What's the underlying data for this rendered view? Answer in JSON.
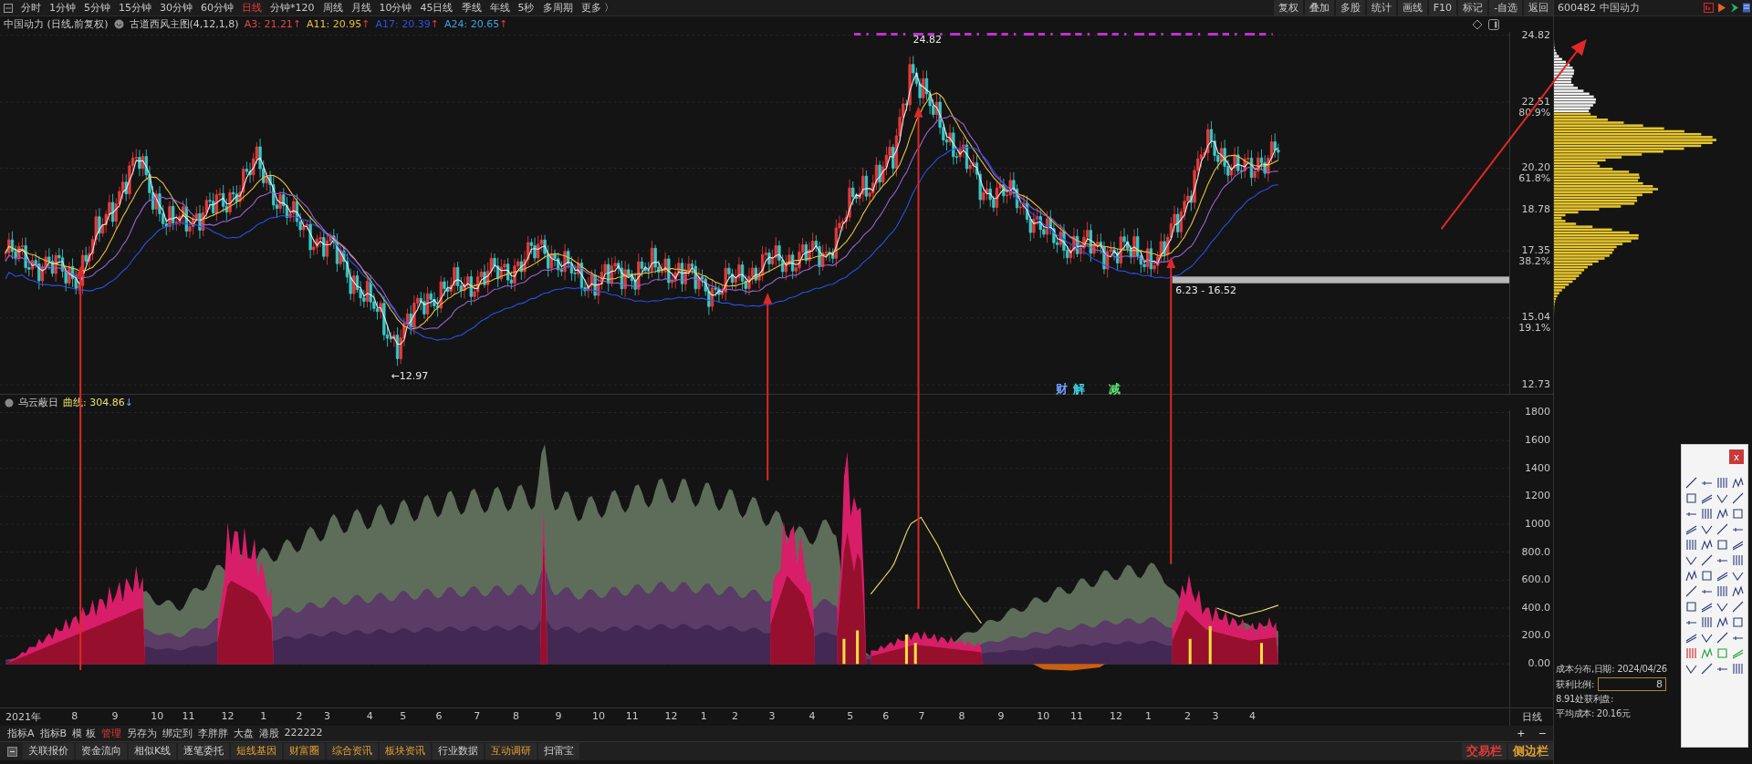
{
  "toolbar": {
    "periods": [
      {
        "label": "分时",
        "selected": false
      },
      {
        "label": "1分钟",
        "selected": false
      },
      {
        "label": "5分钟",
        "selected": false
      },
      {
        "label": "15分钟",
        "selected": false
      },
      {
        "label": "30分钟",
        "selected": false
      },
      {
        "label": "60分钟",
        "selected": false
      },
      {
        "label": "日线",
        "selected": true
      },
      {
        "label": "分钟*120",
        "selected": false
      },
      {
        "label": "周线",
        "selected": false
      },
      {
        "label": "月线",
        "selected": false
      },
      {
        "label": "10分钟",
        "selected": false
      },
      {
        "label": "45日线",
        "selected": false
      },
      {
        "label": "季线",
        "selected": false
      },
      {
        "label": "年线",
        "selected": false
      },
      {
        "label": "5秒",
        "selected": false
      },
      {
        "label": "多周期",
        "selected": false
      },
      {
        "label": "更多 〉",
        "selected": false
      }
    ],
    "buttons": [
      "复权",
      "叠加",
      "多股",
      "统计",
      "画线",
      "F10",
      "标记",
      "-自选",
      "返回"
    ]
  },
  "chart_header": {
    "stock": "中国动力 (日线,前复权)",
    "formula": "古道西风主图(4,12,1,8)",
    "indicators": [
      {
        "label": "A3: 21.21",
        "arrow": "↑",
        "color": "#e04848"
      },
      {
        "label": "A11: 20.95",
        "arrow": "↑",
        "color": "#e8c040"
      },
      {
        "label": "A17: 20.39",
        "arrow": "↑",
        "color": "#3050e0"
      },
      {
        "label": "A24: 20.65",
        "arrow": "↑",
        "color": "#40a0e8"
      }
    ]
  },
  "price_chart": {
    "axis_labels": [
      {
        "price": "24.82"
      },
      {
        "price": "22.51",
        "percent": "80.9%"
      },
      {
        "price": "20.20",
        "percent": "61.8%"
      },
      {
        "price": "18.78"
      },
      {
        "price": "17.35",
        "percent": "38.2%"
      },
      {
        "price": "15.04",
        "percent": "19.1%"
      },
      {
        "price": "12.73"
      }
    ],
    "high_label": "24.82",
    "low_label": "←12.97",
    "range_label": "6.23 - 16.52",
    "markers": [
      {
        "text": "财",
        "color": "#70a0ff"
      },
      {
        "text": "解",
        "color": "#40d0e0"
      },
      {
        "text": "减",
        "color": "#60e070"
      }
    ]
  },
  "indicator": {
    "name": "乌云蔽日",
    "value_label": "曲线: 304.86",
    "arrow": "↓",
    "axis_labels": [
      "1800",
      "1600",
      "1400",
      "1200",
      "1000",
      "800.0",
      "600.0",
      "400.0",
      "200.0",
      "0.00"
    ]
  },
  "time_axis": [
    "2021年",
    "8",
    "9",
    "10",
    "11",
    "12",
    "1",
    "2",
    "3",
    "4",
    "5",
    "6",
    "7",
    "8",
    "9",
    "10",
    "11",
    "12",
    "1",
    "2",
    "3",
    "4",
    "5",
    "6",
    "7",
    "8",
    "9",
    "10",
    "11",
    "12",
    "1",
    "2",
    "3",
    "4"
  ],
  "period_label": "日线",
  "tabs": [
    {
      "label": "指标A",
      "selected": false
    },
    {
      "label": "指标B",
      "selected": false
    },
    {
      "label": "模 板",
      "selected": false
    },
    {
      "label": "管理",
      "selected": true
    },
    {
      "label": "另存为",
      "selected": false
    },
    {
      "label": "绑定到",
      "selected": false
    },
    {
      "label": "李胖胖",
      "selected": false
    },
    {
      "label": "大盘",
      "selected": false
    },
    {
      "label": "港股",
      "selected": false
    },
    {
      "label": "222222",
      "selected": false
    }
  ],
  "zoom_buttons": [
    "+",
    "−"
  ],
  "bottom_bar": {
    "items": [
      {
        "label": "关联报价",
        "highlighted": false
      },
      {
        "label": "资金流向",
        "highlighted": false
      },
      {
        "label": "相似K线",
        "highlighted": false
      },
      {
        "label": "逐笔委托",
        "highlighted": false
      },
      {
        "label": "短线基因",
        "highlighted": true
      },
      {
        "label": "财富圈",
        "highlighted": true
      },
      {
        "label": "综合资讯",
        "highlighted": true
      },
      {
        "label": "板块资讯",
        "highlighted": true
      },
      {
        "label": "行业数据",
        "highlighted": false
      },
      {
        "label": "互动调研",
        "highlighted": true
      },
      {
        "label": "扫雷宝",
        "highlighted": false
      }
    ],
    "side_buttons": [
      {
        "label": "交易栏",
        "color": "#e03a3a"
      },
      {
        "label": "侧边栏",
        "color": "#e0a030"
      }
    ]
  },
  "side_panel": {
    "code": "600482",
    "name": "中国动力",
    "cost": {
      "title": "成本分布,日期: 2024/04/26",
      "ratio_label": "获利比例:",
      "ratio_value": "8",
      "profit_line": "8.91处获利盘:",
      "avg_cost": "平均成本: 20.16元"
    },
    "tools_close": "x"
  }
}
